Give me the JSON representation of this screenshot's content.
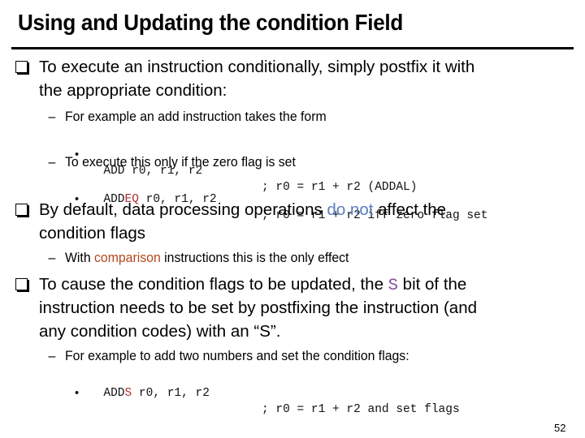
{
  "slide": {
    "title": "Using and Updating the condition Field",
    "page_number": "52",
    "colors": {
      "blue_emphasis": "#5b7fbf",
      "orange_emphasis": "#b5461b",
      "red_code": "#b03030",
      "purple_code": "#8a4aa0"
    }
  },
  "bullets": {
    "b1": {
      "line1": "To execute an instruction conditionally, simply postfix it with",
      "line2": "the appropriate condition:",
      "sub1": "For example an add instruction takes the form",
      "code1": {
        "prefix": "ADD r0, r1, r2",
        "comment": "; r0 = r1 + r2 (ADDAL)"
      },
      "sub2": "To execute this only if the zero flag is set",
      "code2": {
        "prefix": "ADD",
        "highlight": "EQ",
        "rest": " r0, r1, r2",
        "comment": "; r0 = r1 + r2 iff zero flag set"
      }
    },
    "b2": {
      "line1_pre": "By default, data processing operations ",
      "line1_highlight": "do not",
      "line1_post": " affect the",
      "line2": "condition flags",
      "sub1_pre": "With ",
      "sub1_highlight": "comparison",
      "sub1_post": " instructions this is the only effect"
    },
    "b3": {
      "line1_pre": "To cause the condition flags to be updated, the ",
      "line1_highlight": "S",
      "line1_post": " bit of the",
      "line2": "instruction needs to be set by postfixing the instruction (and",
      "line3": "any condition codes) with an “S”.",
      "sub1": "For example to add two numbers and set the condition flags:",
      "code1": {
        "prefix": "ADD",
        "highlight": "S",
        "rest": " r0, r1, r2",
        "comment": "; r0 = r1 + r2 and set flags"
      }
    }
  },
  "glyphs": {
    "bullet1": "checkbox-bullet",
    "dash": "–",
    "dot": "•"
  }
}
